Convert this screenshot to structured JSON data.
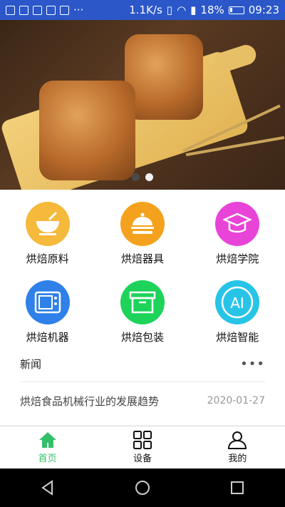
{
  "status": {
    "speed": "1.1K/s",
    "battery": "18%",
    "time": "09:23"
  },
  "banner": {
    "dots": 2,
    "active_index": 1
  },
  "categories": [
    {
      "label": "烘焙原料",
      "icon": "bowl-icon",
      "color": "#f5b93b"
    },
    {
      "label": "烘焙器具",
      "icon": "cloche-icon",
      "color": "#f4a21d"
    },
    {
      "label": "烘焙学院",
      "icon": "graduation-cap-icon",
      "color": "#e844d8"
    },
    {
      "label": "烘焙机器",
      "icon": "oven-icon",
      "color": "#2f80e8"
    },
    {
      "label": "烘焙包装",
      "icon": "box-icon",
      "color": "#1ed35a"
    },
    {
      "label": "烘焙智能",
      "icon": "ai-icon",
      "color": "#27c4e8",
      "text": "AI"
    }
  ],
  "news": {
    "title": "新闻",
    "more": "•••",
    "items": [
      {
        "text": "烘焙食品机械行业的发展趋势",
        "date": "2020-01-27"
      }
    ]
  },
  "tabs": [
    {
      "label": "首页",
      "icon": "home-icon",
      "active": true
    },
    {
      "label": "设备",
      "icon": "grid-icon",
      "active": false
    },
    {
      "label": "我的",
      "icon": "user-icon",
      "active": false
    }
  ],
  "colors": {
    "statusbar": "#2b57c9",
    "active_tab": "#34c06a"
  }
}
